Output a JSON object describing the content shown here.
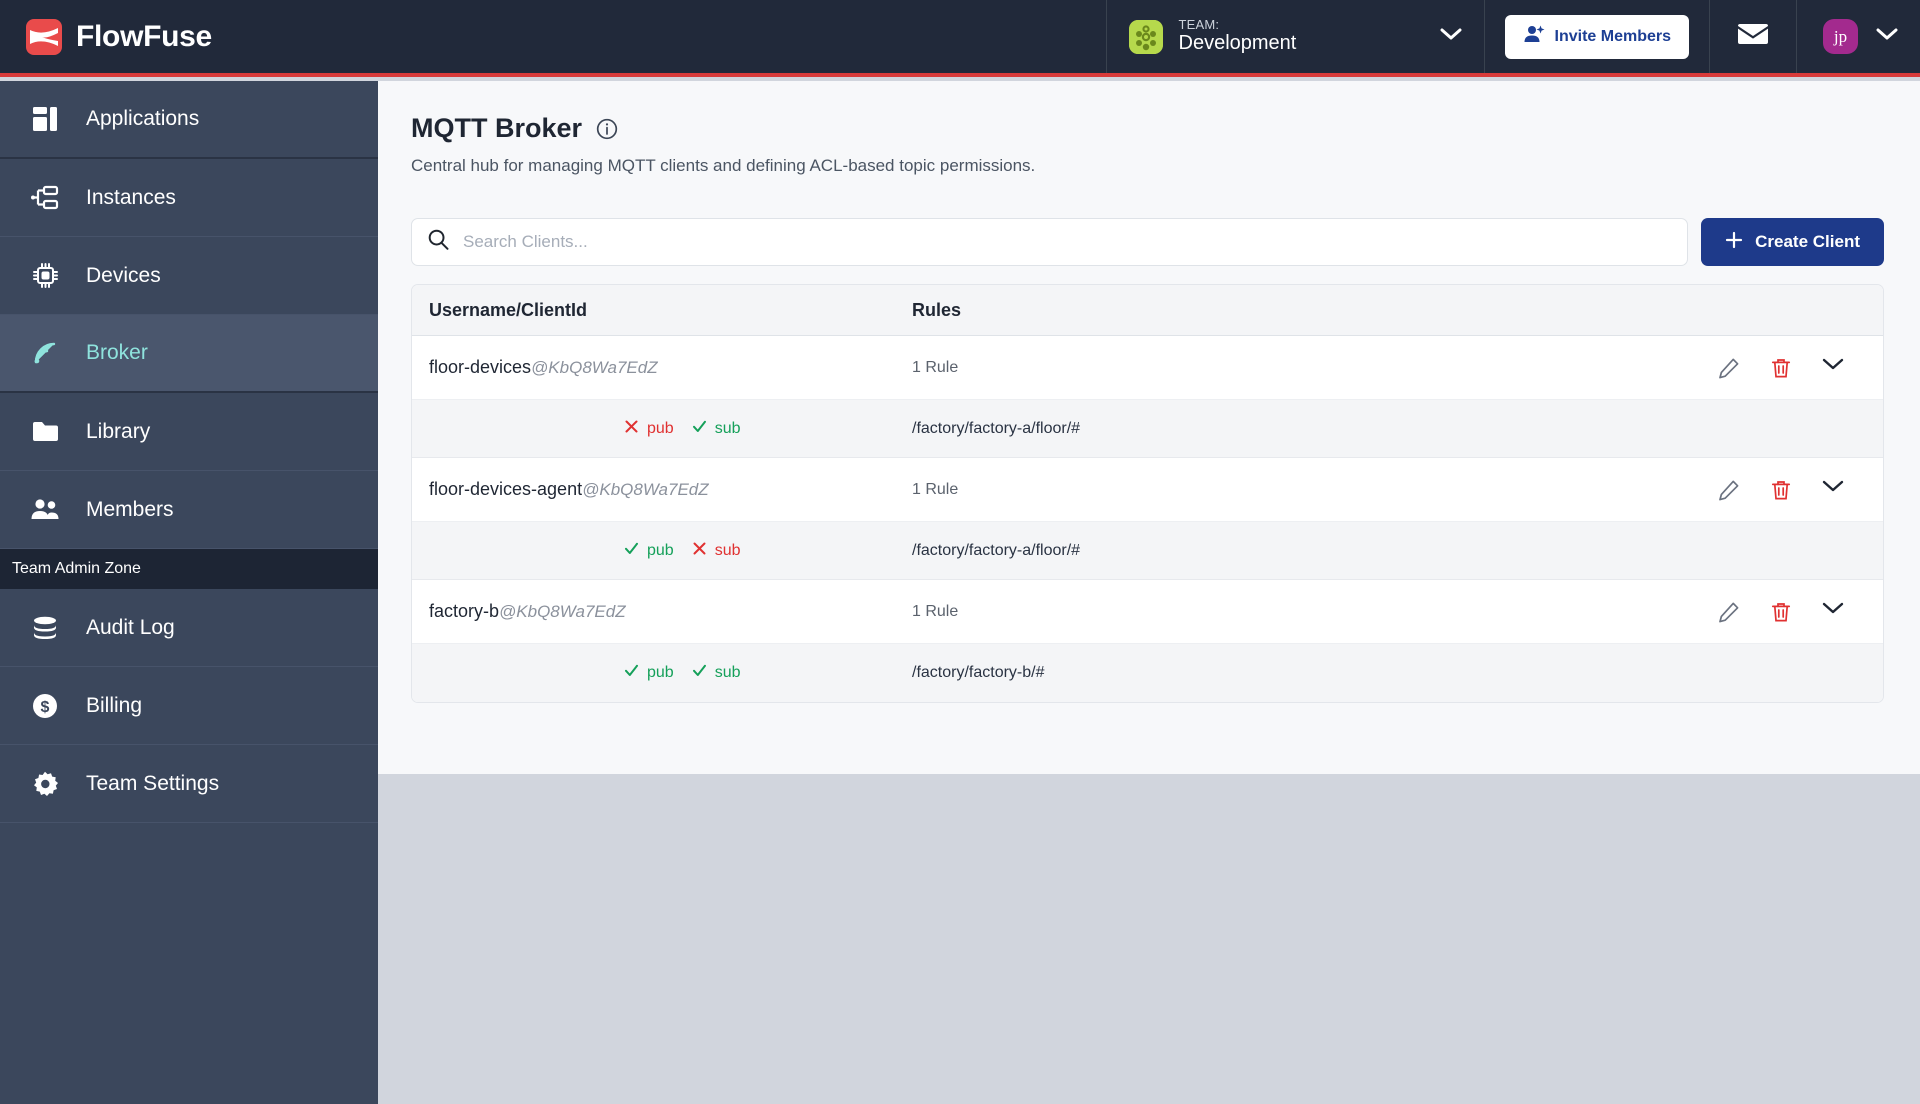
{
  "brand": {
    "name": "FlowFuse",
    "logo_icon": "flowfuse-logo-icon",
    "accent_red": "#e94b4b"
  },
  "header": {
    "team": {
      "kicker": "TEAM:",
      "name": "Development",
      "avatar_icon": "team-avatar-icon",
      "chevron_icon": "chevron-down-icon"
    },
    "invite": {
      "label": "Invite Members",
      "icon": "person-add-icon"
    },
    "mail": {
      "icon": "envelope-icon"
    },
    "user": {
      "initials": "jp",
      "chevron_icon": "chevron-down-icon",
      "avatar_color": "#a32a8e"
    }
  },
  "sidebar": {
    "zone_label": "Team Admin Zone",
    "items": [
      {
        "label": "Applications",
        "icon": "applications-icon",
        "active": false
      },
      {
        "label": "Instances",
        "icon": "instances-icon",
        "active": false
      },
      {
        "label": "Devices",
        "icon": "devices-chip-icon",
        "active": false
      },
      {
        "label": "Broker",
        "icon": "broker-signal-icon",
        "active": true
      },
      {
        "label": "Library",
        "icon": "folder-icon",
        "active": false
      },
      {
        "label": "Members",
        "icon": "members-icon",
        "active": false
      }
    ],
    "admin_items": [
      {
        "label": "Audit Log",
        "icon": "database-icon",
        "active": false
      },
      {
        "label": "Billing",
        "icon": "dollar-circle-icon",
        "active": false
      },
      {
        "label": "Team Settings",
        "icon": "gear-icon",
        "active": false
      }
    ],
    "active_color": "#8fe3dd"
  },
  "page": {
    "title": "MQTT Broker",
    "info_icon": "info-circle-icon",
    "subtitle": "Central hub for managing MQTT clients and defining ACL-based topic permissions."
  },
  "toolbar": {
    "search_placeholder": "Search Clients...",
    "search_value": "",
    "search_icon": "search-icon",
    "create_label": "Create Client",
    "create_icon": "plus-icon",
    "create_color": "#1e3a8a"
  },
  "table": {
    "columns": [
      "Username/ClientId",
      "Rules"
    ],
    "edit_icon": "pencil-icon",
    "delete_icon": "trash-icon",
    "expand_icon": "chevron-down-icon",
    "rows": [
      {
        "username": "floor-devices",
        "client_id": "@KbQ8Wa7EdZ",
        "rules_count": "1 Rule",
        "rules": [
          {
            "pub": {
              "label": "pub",
              "allowed": false
            },
            "sub": {
              "label": "sub",
              "allowed": true
            },
            "topic": "/factory/factory-a/floor/#"
          }
        ]
      },
      {
        "username": "floor-devices-agent",
        "client_id": "@KbQ8Wa7EdZ",
        "rules_count": "1 Rule",
        "rules": [
          {
            "pub": {
              "label": "pub",
              "allowed": true
            },
            "sub": {
              "label": "sub",
              "allowed": false
            },
            "topic": "/factory/factory-a/floor/#"
          }
        ]
      },
      {
        "username": "factory-b",
        "client_id": "@KbQ8Wa7EdZ",
        "rules_count": "1 Rule",
        "rules": [
          {
            "pub": {
              "label": "pub",
              "allowed": true
            },
            "sub": {
              "label": "sub",
              "allowed": true
            },
            "topic": "/factory/factory-b/#"
          }
        ]
      }
    ]
  },
  "colors": {
    "allow": "#15a05a",
    "deny": "#e03131",
    "sidebar": "#3b475c",
    "header": "#21293a"
  }
}
